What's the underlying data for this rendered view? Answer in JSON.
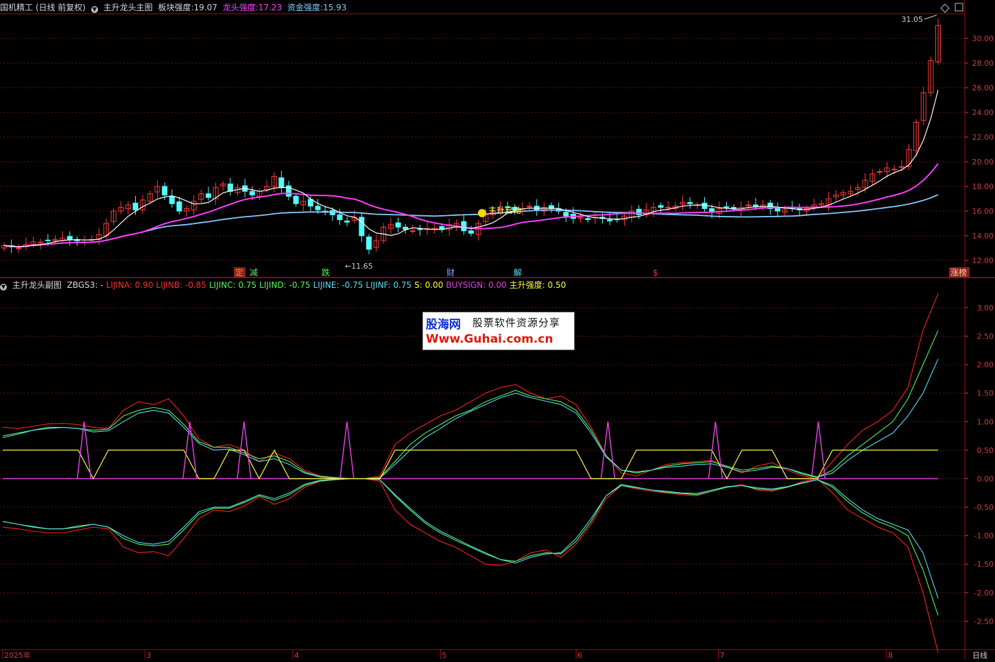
{
  "colors": {
    "bg": "#000000",
    "frame": "#a01010",
    "up": "#ff3b3b",
    "down": "#54fcfc",
    "ma_white": "#ffffff",
    "ma_magenta": "#ff3cff",
    "ma_blue": "#86ccff",
    "lijin_a": "#ff2020",
    "lijin_c": "#54f854",
    "lijin_e": "#54e0f8",
    "buysign": "#e040e0",
    "zhusheng": "#ffff40",
    "axis_text": "#c84040",
    "grid": "#6a1010"
  },
  "main_header": {
    "title": "国机精工 (日线 前复权)",
    "indicator": "主升龙头主图",
    "bankuai_label": "板块强度:",
    "bankuai_value": "19.07",
    "longtou_label": "龙头强度:",
    "longtou_value": "17.23",
    "zijin_label": "资金强度:",
    "zijin_value": "15.93"
  },
  "sub_header": {
    "indicator": "主升龙头副图",
    "items": [
      {
        "label": "ZBGS3: -",
        "color": "#d8d8d8"
      },
      {
        "label": "LIJINA: 0.90",
        "color": "#ff3030"
      },
      {
        "label": "LIJINB: -0.85",
        "color": "#ff3030"
      },
      {
        "label": "LIJINC: 0.75",
        "color": "#54f854"
      },
      {
        "label": "LIJIND: -0.75",
        "color": "#54f854"
      },
      {
        "label": "LIJINE: -0.75",
        "color": "#54e0f8"
      },
      {
        "label": "LIJINF: 0.75",
        "color": "#54e0f8"
      },
      {
        "label": "S: 0.00",
        "color": "#ffff40"
      },
      {
        "label": "BUYSIGN: 0.00",
        "color": "#e040e0"
      },
      {
        "label": "主升强度: 0.50",
        "color": "#ffff40"
      }
    ]
  },
  "annotations": {
    "high_label": "31.05",
    "low_label": "11.65",
    "signal_label": "主升启动",
    "markers": [
      {
        "text": "定",
        "pos": 0.245,
        "color": "#ff8a2a",
        "boxed": true
      },
      {
        "text": "减",
        "pos": 0.26,
        "color": "#54f854",
        "boxed": false
      },
      {
        "text": "跌",
        "pos": 0.335,
        "color": "#54f854",
        "boxed": false
      },
      {
        "text": "财",
        "pos": 0.465,
        "color": "#86a8ff",
        "boxed": false
      },
      {
        "text": "解",
        "pos": 0.535,
        "color": "#54e0f8",
        "boxed": false
      },
      {
        "text": "$",
        "pos": 0.68,
        "color": "#ff3030",
        "boxed": false
      },
      {
        "text": "涨榜",
        "pos": 0.99,
        "color": "#ffd0a0",
        "boxed": true
      }
    ]
  },
  "x_axis": {
    "labels": [
      {
        "text": "2025年",
        "pos": 0.0
      },
      {
        "text": "3",
        "pos": 0.152
      },
      {
        "text": "4",
        "pos": 0.31
      },
      {
        "text": "5",
        "pos": 0.468
      },
      {
        "text": "6",
        "pos": 0.613
      },
      {
        "text": "7",
        "pos": 0.765
      },
      {
        "text": "8",
        "pos": 0.945
      }
    ],
    "period_label": "日线"
  },
  "chart_data": [
    {
      "type": "candlestick",
      "title": "主升龙头主图",
      "ylim": [
        11,
        32
      ],
      "yticks": [
        12,
        14,
        16,
        18,
        20,
        22,
        24,
        26,
        28,
        30
      ],
      "ytick_labels": [
        "12.00",
        "14.00",
        "16.00",
        "18.00",
        "20.00",
        "22.00",
        "24.00",
        "26.00",
        "28.00",
        "30.00"
      ],
      "grid": true,
      "close": [
        13.2,
        13.1,
        13.0,
        13.3,
        13.5,
        13.5,
        13.6,
        13.7,
        13.8,
        13.7,
        13.6,
        13.5,
        13.7,
        14.1,
        15.0,
        16.0,
        16.3,
        16.5,
        16.1,
        16.9,
        17.4,
        18.0,
        17.3,
        16.6,
        16.0,
        16.2,
        16.8,
        17.4,
        17.1,
        17.9,
        18.2,
        17.6,
        17.9,
        17.6,
        17.3,
        17.6,
        18.0,
        18.8,
        17.9,
        17.2,
        16.6,
        16.8,
        16.4,
        16.1,
        15.9,
        15.7,
        15.3,
        15.1,
        15.5,
        14.0,
        12.9,
        13.6,
        14.7,
        14.9,
        14.7,
        14.5,
        14.4,
        14.5,
        14.6,
        14.6,
        14.5,
        14.9,
        15.0,
        14.4,
        14.2,
        15.0,
        15.7,
        16.0,
        16.2,
        16.3,
        16.1,
        16.2,
        16.4,
        16.1,
        16.3,
        16.2,
        16.0,
        15.6,
        15.4,
        15.5,
        15.3,
        15.5,
        15.4,
        15.2,
        15.3,
        15.6,
        16.0,
        15.7,
        16.1,
        16.3,
        16.3,
        16.3,
        16.4,
        16.7,
        16.6,
        16.5,
        16.2,
        15.9,
        16.2,
        16.3,
        16.2,
        16.3,
        16.5,
        16.4,
        16.5,
        16.2,
        16.0,
        16.1,
        16.2,
        16.1,
        16.2,
        16.5,
        16.6,
        17.0,
        17.3,
        17.5,
        17.6,
        17.9,
        18.5,
        19.0,
        19.2,
        19.5,
        19.4,
        19.6,
        21.0,
        23.2,
        25.6,
        28.2,
        31.05
      ],
      "ma_white": "fast moving average (values drawn from series)",
      "ma_magenta": "medium moving average",
      "ma_blue": "slow moving average"
    },
    {
      "type": "line",
      "title": "主升龙头副图",
      "ylim": [
        -3.0,
        3.3
      ],
      "yticks": [
        -2.5,
        -2.0,
        -1.5,
        -1.0,
        -0.5,
        0.0,
        0.5,
        1.0,
        1.5,
        2.0,
        2.5,
        3.0
      ],
      "ytick_labels": [
        "-2.50",
        "-2.00",
        "-1.50",
        "-1.00",
        "-0.50",
        "0.00",
        "0.50",
        "1.00",
        "1.50",
        "2.00",
        "2.50",
        "3.00"
      ],
      "grid": true,
      "series": [
        {
          "name": "LIJINA",
          "values": [
            0.9,
            0.88,
            0.92,
            0.96,
            0.97,
            0.95,
            0.9,
            0.88,
            1.2,
            1.35,
            1.3,
            1.4,
            1.1,
            0.7,
            0.55,
            0.6,
            0.5,
            0.3,
            0.45,
            0.35,
            0.15,
            0.05,
            0.02,
            0.0,
            0.0,
            0.05,
            0.6,
            0.8,
            0.95,
            1.1,
            1.2,
            1.35,
            1.5,
            1.6,
            1.65,
            1.5,
            1.4,
            1.45,
            1.3,
            0.9,
            0.4,
            0.1,
            0.05,
            0.15,
            0.25,
            0.28,
            0.3,
            0.32,
            0.2,
            0.1,
            0.22,
            0.28,
            0.15,
            0.05,
            0.0,
            0.3,
            0.6,
            0.85,
            1.0,
            1.2,
            1.6,
            2.6,
            3.25
          ]
        },
        {
          "name": "LIJINC",
          "values": [
            0.75,
            0.8,
            0.85,
            0.9,
            0.9,
            0.88,
            0.85,
            0.87,
            1.1,
            1.2,
            1.25,
            1.2,
            0.95,
            0.65,
            0.55,
            0.55,
            0.45,
            0.35,
            0.4,
            0.3,
            0.12,
            0.04,
            0.02,
            0.0,
            0.0,
            0.02,
            0.3,
            0.6,
            0.8,
            0.95,
            1.1,
            1.2,
            1.35,
            1.45,
            1.55,
            1.45,
            1.4,
            1.35,
            1.2,
            0.85,
            0.4,
            0.15,
            0.1,
            0.15,
            0.22,
            0.26,
            0.28,
            0.3,
            0.22,
            0.15,
            0.18,
            0.22,
            0.18,
            0.08,
            0.02,
            0.15,
            0.4,
            0.6,
            0.8,
            1.0,
            1.4,
            2.0,
            2.6
          ]
        },
        {
          "name": "LIJINE",
          "values": [
            0.72,
            0.78,
            0.85,
            0.88,
            0.9,
            0.88,
            0.82,
            0.84,
            1.0,
            1.15,
            1.2,
            1.15,
            0.9,
            0.62,
            0.5,
            0.52,
            0.42,
            0.3,
            0.35,
            0.25,
            0.1,
            0.03,
            0.01,
            0.0,
            0.0,
            0.01,
            0.25,
            0.5,
            0.72,
            0.88,
            1.05,
            1.18,
            1.3,
            1.42,
            1.5,
            1.42,
            1.36,
            1.3,
            1.15,
            0.8,
            0.38,
            0.15,
            0.12,
            0.15,
            0.2,
            0.22,
            0.25,
            0.26,
            0.2,
            0.12,
            0.15,
            0.2,
            0.18,
            0.1,
            0.03,
            0.1,
            0.32,
            0.5,
            0.65,
            0.8,
            1.1,
            1.5,
            2.1
          ]
        },
        {
          "name": "LIJINB",
          "values": [
            -0.85,
            -0.88,
            -0.92,
            -0.95,
            -0.95,
            -0.9,
            -0.85,
            -0.88,
            -1.2,
            -1.3,
            -1.28,
            -1.35,
            -1.05,
            -0.7,
            -0.55,
            -0.58,
            -0.48,
            -0.32,
            -0.45,
            -0.35,
            -0.15,
            -0.05,
            -0.02,
            0.0,
            0.0,
            -0.05,
            -0.55,
            -0.8,
            -0.95,
            -1.1,
            -1.2,
            -1.35,
            -1.5,
            -1.52,
            -1.45,
            -1.3,
            -1.25,
            -1.38,
            -1.15,
            -0.8,
            -0.35,
            -0.12,
            -0.18,
            -0.22,
            -0.25,
            -0.28,
            -0.3,
            -0.22,
            -0.15,
            -0.1,
            -0.2,
            -0.22,
            -0.15,
            -0.05,
            0.0,
            -0.25,
            -0.55,
            -0.7,
            -0.85,
            -0.95,
            -1.2,
            -2.0,
            -3.05
          ]
        },
        {
          "name": "LIJIND",
          "values": [
            -0.75,
            -0.8,
            -0.85,
            -0.88,
            -0.88,
            -0.85,
            -0.8,
            -0.85,
            -1.05,
            -1.15,
            -1.18,
            -1.15,
            -0.9,
            -0.62,
            -0.52,
            -0.52,
            -0.42,
            -0.3,
            -0.38,
            -0.28,
            -0.12,
            -0.04,
            -0.02,
            0.0,
            0.0,
            -0.02,
            -0.3,
            -0.55,
            -0.78,
            -0.95,
            -1.08,
            -1.2,
            -1.32,
            -1.42,
            -1.45,
            -1.35,
            -1.3,
            -1.32,
            -1.1,
            -0.75,
            -0.3,
            -0.1,
            -0.15,
            -0.2,
            -0.24,
            -0.26,
            -0.28,
            -0.22,
            -0.15,
            -0.12,
            -0.18,
            -0.2,
            -0.15,
            -0.08,
            -0.02,
            -0.15,
            -0.4,
            -0.6,
            -0.75,
            -0.85,
            -1.0,
            -1.6,
            -2.4
          ]
        },
        {
          "name": "LIJINF",
          "values": [
            -0.75,
            -0.8,
            -0.84,
            -0.88,
            -0.88,
            -0.83,
            -0.8,
            -0.85,
            -1.0,
            -1.12,
            -1.15,
            -1.1,
            -0.85,
            -0.58,
            -0.5,
            -0.5,
            -0.4,
            -0.28,
            -0.35,
            -0.25,
            -0.1,
            -0.03,
            -0.01,
            0.0,
            0.0,
            -0.02,
            -0.28,
            -0.52,
            -0.75,
            -0.92,
            -1.05,
            -1.18,
            -1.3,
            -1.42,
            -1.48,
            -1.38,
            -1.32,
            -1.3,
            -1.05,
            -0.7,
            -0.3,
            -0.12,
            -0.16,
            -0.2,
            -0.22,
            -0.25,
            -0.26,
            -0.2,
            -0.14,
            -0.12,
            -0.16,
            -0.18,
            -0.14,
            -0.07,
            -0.02,
            -0.12,
            -0.35,
            -0.55,
            -0.7,
            -0.8,
            -0.9,
            -1.3,
            -2.1
          ]
        },
        {
          "name": "主升强度",
          "values": [
            0.5,
            0.5,
            0.5,
            0.5,
            0.5,
            0.5,
            0.0,
            0.5,
            0.5,
            0.5,
            0.5,
            0.5,
            0.5,
            0.0,
            0.0,
            0.5,
            0.5,
            0.0,
            0.5,
            0.0,
            0.0,
            0.0,
            0.0,
            0.0,
            0.0,
            0.0,
            0.5,
            0.5,
            0.5,
            0.5,
            0.5,
            0.5,
            0.5,
            0.5,
            0.5,
            0.5,
            0.5,
            0.5,
            0.5,
            0.0,
            0.0,
            0.0,
            0.5,
            0.5,
            0.5,
            0.5,
            0.5,
            0.5,
            0.0,
            0.5,
            0.5,
            0.5,
            0.0,
            0.0,
            0.0,
            0.5,
            0.5,
            0.5,
            0.5,
            0.5,
            0.5,
            0.5,
            0.5
          ]
        },
        {
          "name": "BUYSIGN",
          "spikes_at_fraction": [
            0.087,
            0.2,
            0.258,
            0.368,
            0.647,
            0.762,
            0.872
          ],
          "spike_value": 1.0
        }
      ]
    }
  ],
  "watermark": {
    "brand": "股海网",
    "tagline": "股票软件资源分享",
    "url": "Www.Guhai.com.cn"
  }
}
